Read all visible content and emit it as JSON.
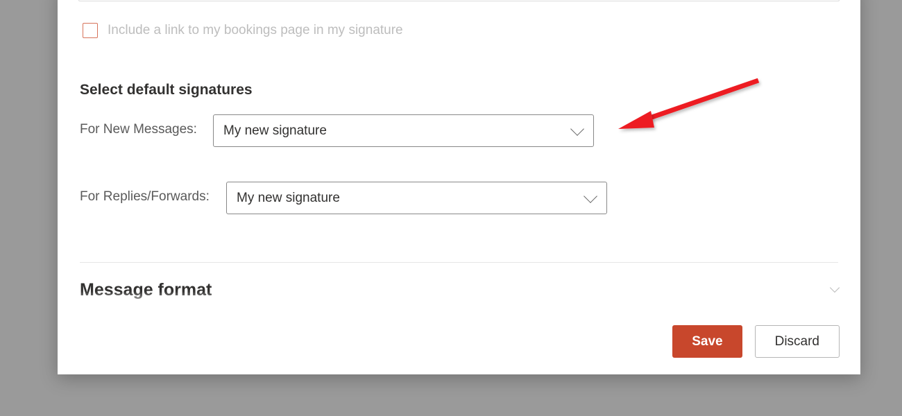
{
  "checkbox": {
    "label": "Include a link to my bookings page in my signature"
  },
  "section_defaults": {
    "heading": "Select default signatures",
    "new_messages_label": "For New Messages:",
    "new_messages_value": "My new signature",
    "replies_label": "For Replies/Forwards:",
    "replies_value": "My new signature"
  },
  "section_message_format": {
    "heading": "Message format"
  },
  "footer": {
    "save": "Save",
    "discard": "Discard"
  }
}
